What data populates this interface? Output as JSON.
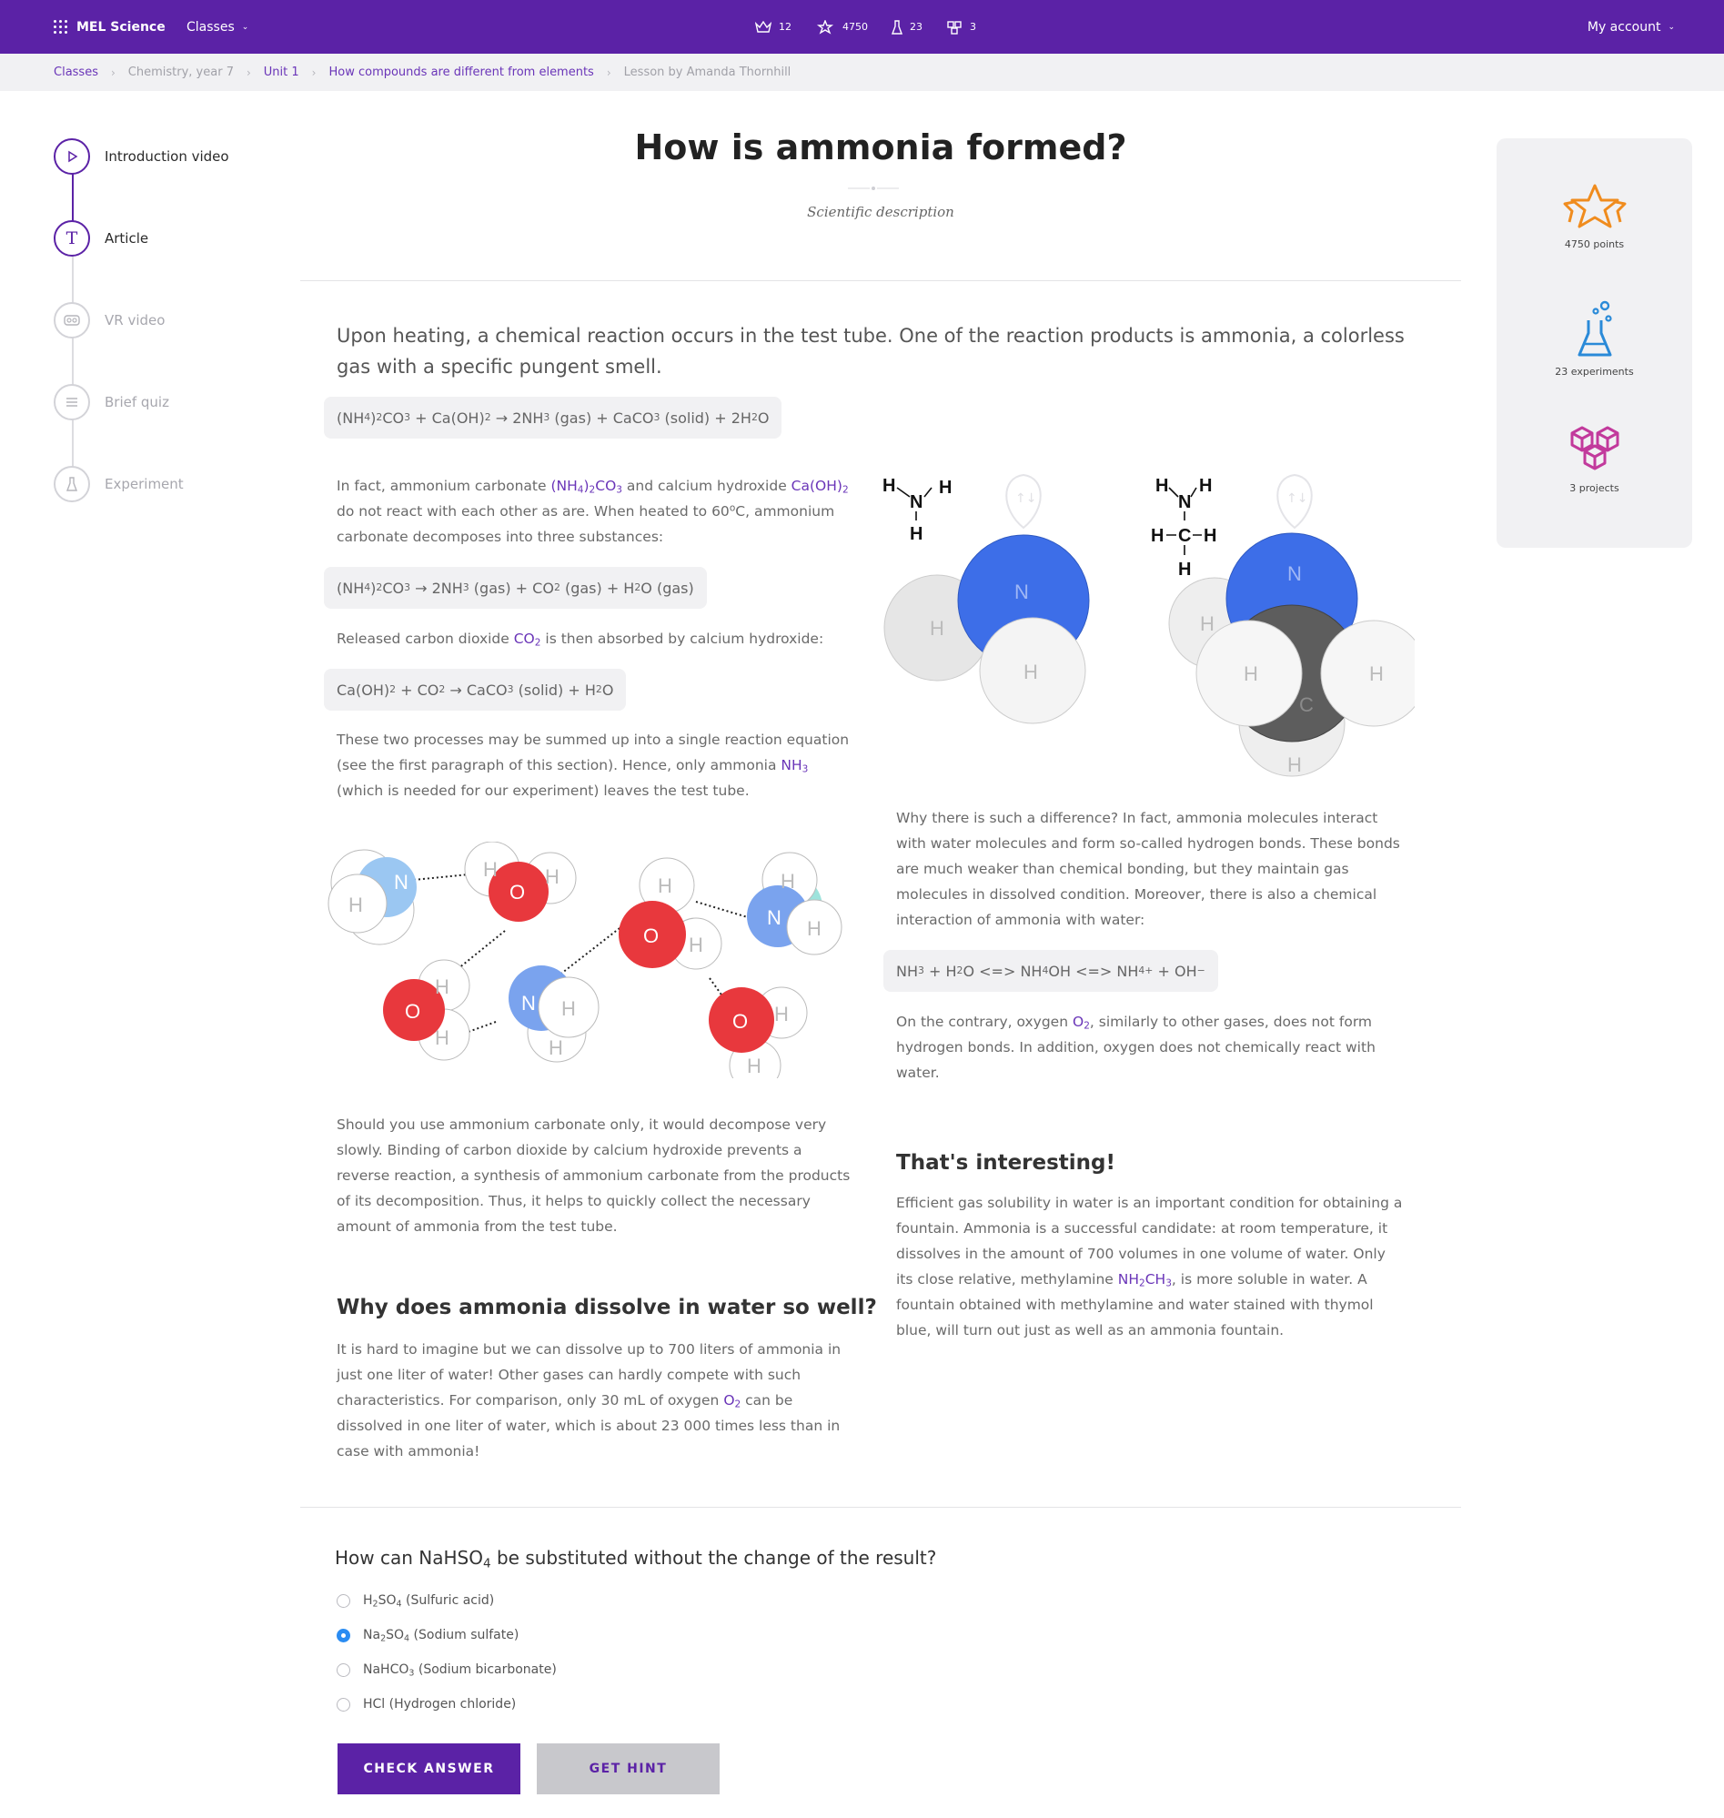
{
  "topbar": {
    "brand": "MEL Science",
    "classes_menu": "Classes",
    "stats": [
      {
        "icon": "crown-icon",
        "value": "12"
      },
      {
        "icon": "stars-icon",
        "value": "4750"
      },
      {
        "icon": "flask-icon",
        "value": "23"
      },
      {
        "icon": "cubes-icon",
        "value": "3"
      }
    ],
    "account_menu": "My account"
  },
  "breadcrumb": [
    "Classes",
    "Chemistry, year 7",
    "Unit 1",
    "How compounds are different from elements",
    "Lesson by Amanda Thornhill"
  ],
  "steps": [
    "Introduction video",
    "Article",
    "VR video",
    "Brief quiz",
    "Experiment"
  ],
  "article": {
    "title": "How is ammonia formed?",
    "subtitle": "Scientific description",
    "intro": "Upon heating, a chemical reaction occurs in the test tube. One of the reaction products is ammonia, a colorless gas with a specific pungent smell.",
    "eq_main": "(NH4)2CO3 + Ca(OH)2 → 2NH3 (gas) + CaCO3 (solid) + 2H2O",
    "p1": "In fact, ammonium carbonate (NH4)2CO3 and calcium hydroxide Ca(OH)2 do not react with each other as are. When heated to 60°C, ammonium carbonate decomposes into three substances:",
    "eq_decomp": "(NH4)2CO3 → 2NH3 (gas) + CO2 (gas) + H2O (gas)",
    "p2": "Released carbon dioxide CO2 is then absorbed by calcium hydroxide:",
    "eq_absorb": "Ca(OH)2 + CO2 → CaCO3 (solid) + H2O",
    "p3": "These two processes may be summed up into a single reaction equation (see the first paragraph of this section). Hence, only ammonia NH3 (which is needed for our experiment) leaves the test tube.",
    "p4": "Should you use ammonium carbonate only, it would decompose very slowly. Binding of carbon dioxide by calcium hydroxide prevents a reverse reaction, a synthesis of ammonium carbonate from the products of its decomposition. Thus, it helps to quickly collect the necessary amount of ammonia from the test tube.",
    "h_dissolve": "Why does ammonia dissolve in water so well?",
    "p5": "It is hard to imagine but we can dissolve up to 700 liters of ammonia in just one liter of water! Other gases can hardly compete with such characteristics. For comparison, only 30 mL of oxygen O2 can be dissolved in one liter of water, which is about 23 000 times less than in case with ammonia!",
    "p6": "Why there is such a difference? In fact, ammonia molecules interact with water molecules and form so-called hydrogen bonds. These bonds are much weaker than chemical bonding, but they maintain gas molecules in dissolved condition. Moreover, there is also a chemical interaction of ammonia with water:",
    "eq_water": "NH3 + H2O <=> NH4OH <=> NH4+ + OH−",
    "p7": "On the contrary, oxygen O2, similarly to other gases, does not form hydrogen bonds. In addition, oxygen does not chemically react with water.",
    "h_interesting": "That's interesting!",
    "p8": "Efficient gas solubility in water is an important condition for obtaining a fountain. Ammonia is a successful candidate: at room temperature, it dissolves in the amount of 700 volumes in one volume of water. Only its close relative, methylamine NH2CH3, is more soluble in water. A fountain obtained with methylamine and water stained with thymol blue, will turn out just as well as an ammonia fountain."
  },
  "molecule_labels": {
    "n": "N",
    "h": "H",
    "o": "O",
    "c": "C"
  },
  "sidebar": [
    {
      "icon": "stars-icon",
      "label": "4750 points",
      "color": "#f08c1e"
    },
    {
      "icon": "flask-icon",
      "label": "23 experiments",
      "color": "#2a8ad8"
    },
    {
      "icon": "cubes-icon",
      "label": "3 projects",
      "color": "#c23a9c"
    }
  ],
  "quiz": {
    "question": "How can NaHSO4 be substituted without the change of the result?",
    "options": [
      "H2SO4 (Sulfuric acid)",
      "Na2SO4 (Sodium sulfate)",
      "NaHCO3 (Sodium bicarbonate)",
      "HCl (Hydrogen chloride)"
    ],
    "selected_index": 1,
    "check_button": "CHECK ANSWER",
    "hint_button": "GET HINT"
  },
  "colors": {
    "brand": "#5b22a6",
    "link": "#6a35b8",
    "radio": "#2a8cf2",
    "nitrogen": "#3d6ee8",
    "oxygen": "#e8383d",
    "carbon": "#5d5d5d"
  }
}
